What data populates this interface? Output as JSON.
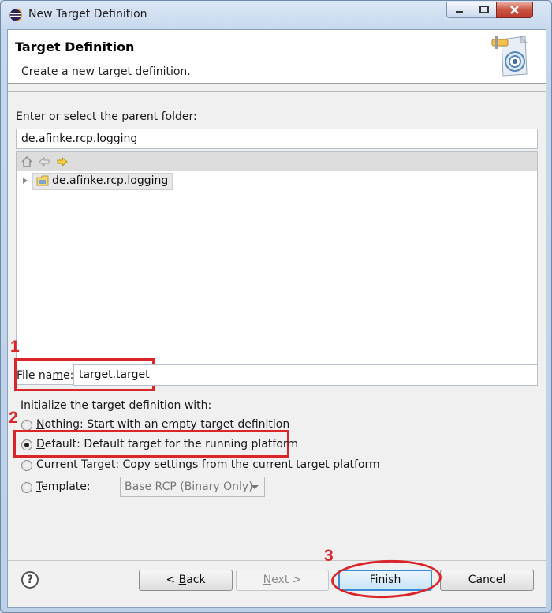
{
  "window": {
    "title": "New Target Definition"
  },
  "banner": {
    "title": "Target Definition",
    "description": "Create a new target definition."
  },
  "parent_folder": {
    "label_pre": "",
    "label_u": "E",
    "label_post": "nter or select the parent folder:",
    "value": "de.afinke.rcp.logging",
    "tree_items": [
      {
        "label": "de.afinke.rcp.logging"
      }
    ],
    "toolbar_icons": [
      "home-icon",
      "back-arrow-icon",
      "forward-arrow-icon"
    ]
  },
  "file_name": {
    "label_pre": "File na",
    "label_u": "m",
    "label_post": "e:",
    "value": "target.target"
  },
  "init": {
    "heading": "Initialize the target definition with:",
    "options": [
      {
        "u": "N",
        "rest": "othing: Start with an empty target definition",
        "selected": false
      },
      {
        "u": "D",
        "rest": "efault: Default target for the running platform",
        "selected": true
      },
      {
        "u": "C",
        "rest": "urrent Target: Copy settings from the current target platform",
        "selected": false
      },
      {
        "u": "T",
        "rest": "emplate:",
        "selected": false
      }
    ],
    "template_value": "Base RCP (Binary Only)"
  },
  "annotations": {
    "step1": "1",
    "step2": "2",
    "step3": "3",
    "color": "#d9262b"
  },
  "buttons": {
    "help": "?",
    "back_pre": "< ",
    "back_u": "B",
    "back_post": "ack",
    "next_pre": "",
    "next_u": "N",
    "next_post": "ext >",
    "finish": "Finish",
    "cancel": "Cancel"
  }
}
